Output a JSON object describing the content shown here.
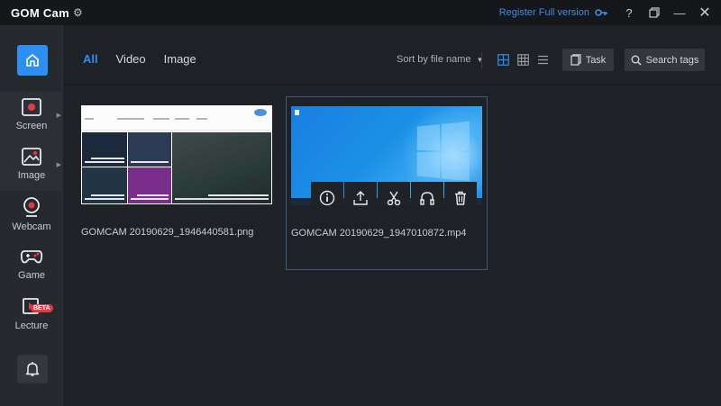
{
  "app": {
    "logo": "GOM Cam",
    "register_label": "Register Full version",
    "help_label": "?",
    "min_label": "—",
    "close_label": "✕"
  },
  "sidebar": {
    "items": [
      {
        "label": "Screen",
        "icon": "screen-record-icon"
      },
      {
        "label": "Image",
        "icon": "image-capture-icon"
      },
      {
        "label": "Webcam",
        "icon": "webcam-icon"
      },
      {
        "label": "Game",
        "icon": "gamepad-icon"
      },
      {
        "label": "Lecture",
        "icon": "lecture-icon",
        "badge": "BETA"
      }
    ]
  },
  "toolbar": {
    "tabs": [
      "All",
      "Video",
      "Image"
    ],
    "sort_label": "Sort by file name",
    "task_label": "Task",
    "search_label": "Search tags"
  },
  "files": [
    {
      "name": "GOMCAM 20190629_1946440581.png"
    },
    {
      "name": "GOMCAM 20190629_1947010872.mp4"
    }
  ],
  "colors": {
    "accent": "#2f8ff0",
    "background": "#1e2125",
    "sidebar": "#26292d",
    "beta_badge": "#e63946"
  }
}
